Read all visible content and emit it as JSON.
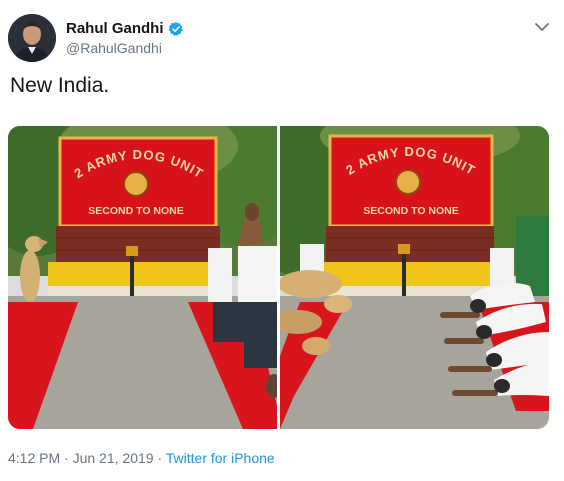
{
  "tweet": {
    "author_name": "Rahul Gandhi",
    "author_handle": "@RahulGandhi",
    "text": "New India.",
    "time": "4:12 PM",
    "separator": " · ",
    "date": "Jun 21, 2019",
    "separator2": " · ",
    "source": "Twitter for iPhone"
  },
  "media": {
    "sign_line1": "2 ARMY DOG UNIT",
    "sign_line2": "SECOND TO NONE"
  },
  "colors": {
    "accent": "#1da1f2",
    "source_link": "#1b95e0",
    "secondary_text": "#657786",
    "sign_red": "#d8121a",
    "sign_text": "#f4d7a8",
    "carpet_red": "#d8141c",
    "wall_yellow": "#f0c419"
  },
  "icons": {
    "verified": "verified-badge-icon",
    "menu": "chevron-down-icon"
  }
}
